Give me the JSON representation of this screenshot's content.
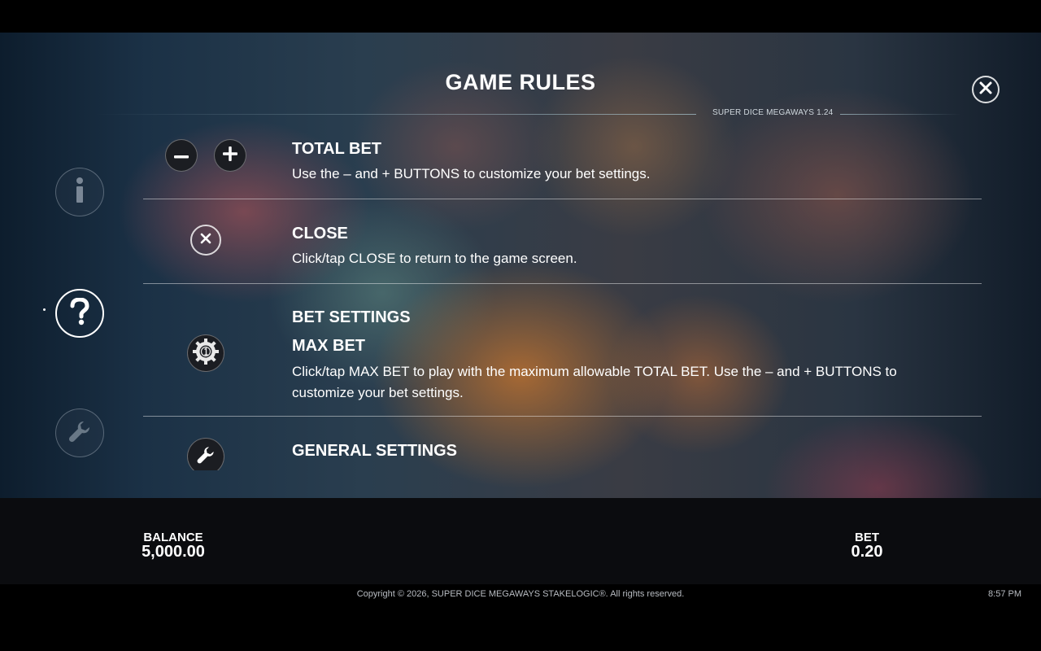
{
  "header": {
    "title": "GAME RULES",
    "version": "SUPER DICE MEGAWAYS 1.24",
    "close_icon": "close-icon"
  },
  "sidebar": {
    "items": [
      {
        "icon": "info-icon",
        "state": "inactive"
      },
      {
        "icon": "help-icon",
        "state": "active"
      },
      {
        "icon": "wrench-icon",
        "state": "inactive"
      }
    ]
  },
  "sections": {
    "total_bet": {
      "title": "TOTAL BET",
      "text": "Use the – and + BUTTONS to customize your bet settings.",
      "icons": [
        "minus-icon",
        "plus-icon"
      ]
    },
    "close": {
      "title": "CLOSE",
      "text": "Click/tap CLOSE to return to the game screen.",
      "icon": "close-icon"
    },
    "bet_settings": {
      "title": "BET SETTINGS",
      "subtitle": "MAX BET",
      "text": "Click/tap MAX BET to play with the maximum allowable TOTAL BET. Use the – and + BUTTONS to customize your bet settings.",
      "icon": "chip-gear-icon"
    },
    "general_settings": {
      "title": "GENERAL SETTINGS",
      "icon": "wrench-icon"
    }
  },
  "footer": {
    "balance_label": "BALANCE",
    "balance_value": "5,000.00",
    "bet_label": "BET",
    "bet_value": "0.20",
    "copyright": "Copyright © 2026, SUPER DICE MEGAWAYS STAKELOGIC®. All rights reserved.",
    "clock": "8:57 PM"
  }
}
